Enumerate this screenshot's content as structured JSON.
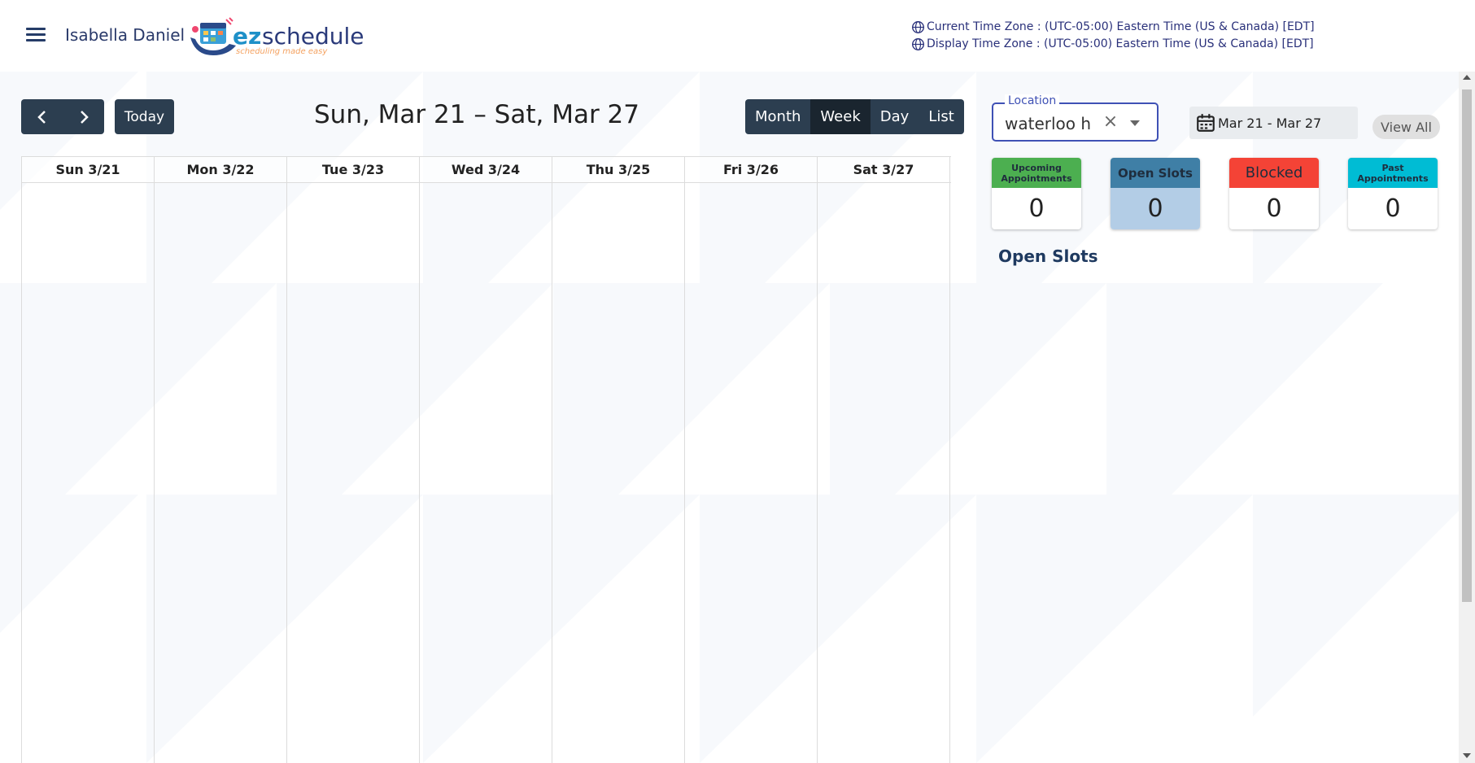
{
  "header": {
    "user_name": "Isabella Daniel",
    "logo": {
      "brand_ez": "ez",
      "brand_rest": "scheduler",
      "tagline": "scheduling made easy"
    },
    "timezones": [
      "Current Time Zone : (UTC-05:00) Eastern Time (US & Canada) [EDT]",
      "Display Time Zone : (UTC-05:00) Eastern Time (US & Canada) [EDT]"
    ]
  },
  "toolbar": {
    "prev_icon": "chevron-left-icon",
    "next_icon": "chevron-right-icon",
    "today_label": "Today",
    "range_title": "Sun, Mar 21 – Sat, Mar 27",
    "views": [
      {
        "label": "Month",
        "active": false
      },
      {
        "label": "Week",
        "active": true
      },
      {
        "label": "Day",
        "active": false
      },
      {
        "label": "List",
        "active": false
      }
    ]
  },
  "calendar": {
    "days": [
      "Sun 3/21",
      "Mon 3/22",
      "Tue 3/23",
      "Wed 3/24",
      "Thu 3/25",
      "Fri 3/26",
      "Sat 3/27"
    ]
  },
  "panel": {
    "location": {
      "label": "Location",
      "value": "waterloo ho"
    },
    "date_range": "Mar 21 - Mar 27",
    "view_all_label": "View All",
    "stats": [
      {
        "label": "Upcoming Appointments",
        "value": "0",
        "color": "#4caf50",
        "text_color": "#1a1a1a"
      },
      {
        "label": "Open Slots",
        "value": "0",
        "color": "#3f7fa6",
        "text_color": "#1a1a1a"
      },
      {
        "label": "Blocked",
        "value": "0",
        "color": "#f44336",
        "text_color": "#1a1a1a"
      },
      {
        "label": "Past Appointments",
        "value": "0",
        "color": "#00bcd4",
        "text_color": "#1a1a1a"
      }
    ],
    "open_slots_title": "Open Slots"
  },
  "colors": {
    "toolbar_bg": "#2c3e50",
    "toolbar_active": "#1a252f",
    "accent": "#3f51b5",
    "open_slots_value_bg": "#b3cde6"
  }
}
